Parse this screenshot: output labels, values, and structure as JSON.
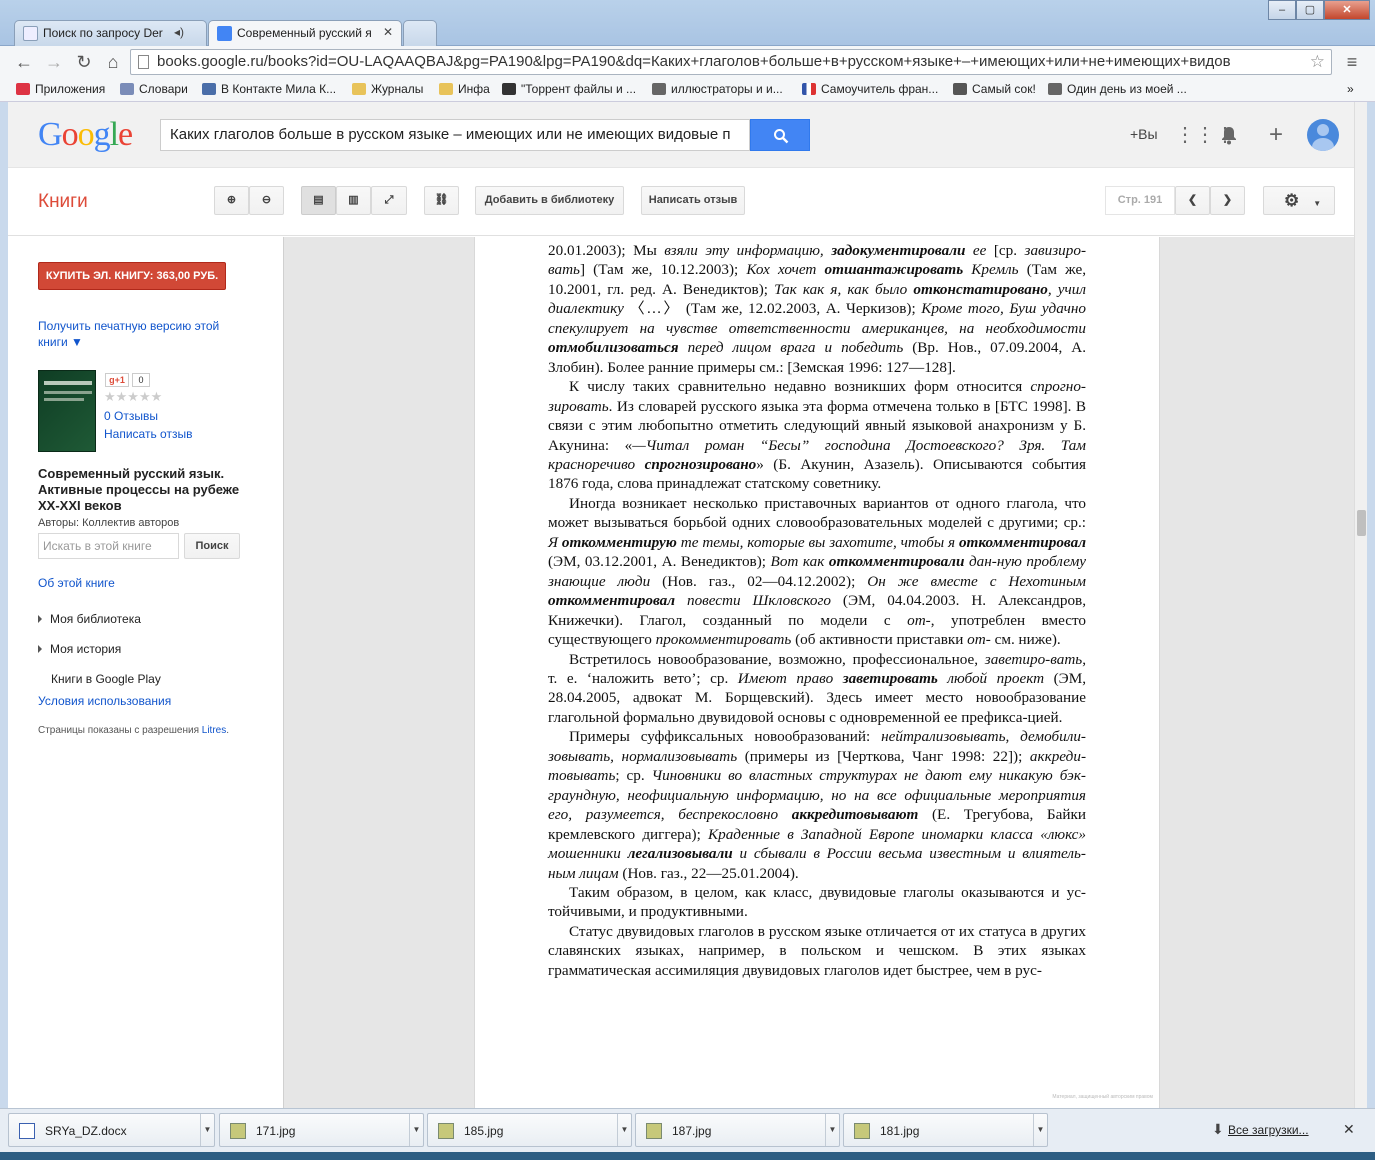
{
  "tabs": [
    {
      "label": "Поиск по запросу Der",
      "active": false
    },
    {
      "label": "Современный русский я",
      "active": true
    },
    {
      "label": "",
      "active": false
    }
  ],
  "address": "books.google.ru/books?id=OU-LAQAAQBAJ&pg=PA190&lpg=PA190&dq=Каких+глаголов+больше+в+русском+языке+–+имеющих+или+не+имеющих+видов",
  "bookmarks": [
    {
      "label": "Приложения",
      "icon_color": "#d34"
    },
    {
      "label": "Словари",
      "icon_color": "#7a8cb8"
    },
    {
      "label": "В Контакте Мила К...",
      "icon_color": "#4a6ea9"
    },
    {
      "label": "Журналы",
      "icon_color": "#e8c35a"
    },
    {
      "label": "Инфа",
      "icon_color": "#e8c35a"
    },
    {
      "label": "\"Торрент файлы и ...",
      "icon_color": "#333"
    },
    {
      "label": "иллюстраторы и и...",
      "icon_color": "#666"
    },
    {
      "label": "Самоучитель фран...",
      "icon_color": "#3355aa"
    },
    {
      "label": "Самый сок!",
      "icon_color": "#555"
    },
    {
      "label": "Один день из моей ...",
      "icon_color": "#666"
    }
  ],
  "google": {
    "search_value": "Каких глаголов больше в русском языке – имеющих или не имеющих видовые п",
    "plus_you": "+Вы"
  },
  "books_bar": {
    "title": "Книги",
    "add_library": "Добавить в библиотеку",
    "write_review": "Написать отзыв",
    "page_label": "Стр. 191"
  },
  "sidebar": {
    "buy": "КУПИТЬ ЭЛ. КНИГУ: 363,00 РУБ.",
    "print_version": "Получить печатную версию этой книги ▼",
    "gplus": "g+1",
    "gplus_count": "0",
    "stars": "★★★★★",
    "rating": 0,
    "reviews": "0 Отзывы",
    "write_review": "Написать отзыв",
    "book_title": "Современный русский язык. Активные процессы на рубеже XX-XXI веков",
    "authors": "Авторы: Коллектив авторов",
    "search_placeholder": "Искать в этой книге",
    "search_button": "Поиск",
    "about": "Об этой книге",
    "my_library": "Моя библиотека",
    "my_history": "Моя история",
    "play": "Книги в Google Play",
    "terms": "Условия использования",
    "perm_text": "Страницы показаны с разрешения ",
    "perm_link": "Litres",
    "perm_end": "."
  },
  "downloads": [
    {
      "name": "SRYa_DZ.docx",
      "type": "doc"
    },
    {
      "name": "171.jpg",
      "type": "jpg"
    },
    {
      "name": "185.jpg",
      "type": "jpg"
    },
    {
      "name": "187.jpg",
      "type": "jpg"
    },
    {
      "name": "181.jpg",
      "type": "jpg"
    }
  ],
  "all_downloads": "Все загрузки...",
  "watermark": "Материал, защищенный авторским правом"
}
